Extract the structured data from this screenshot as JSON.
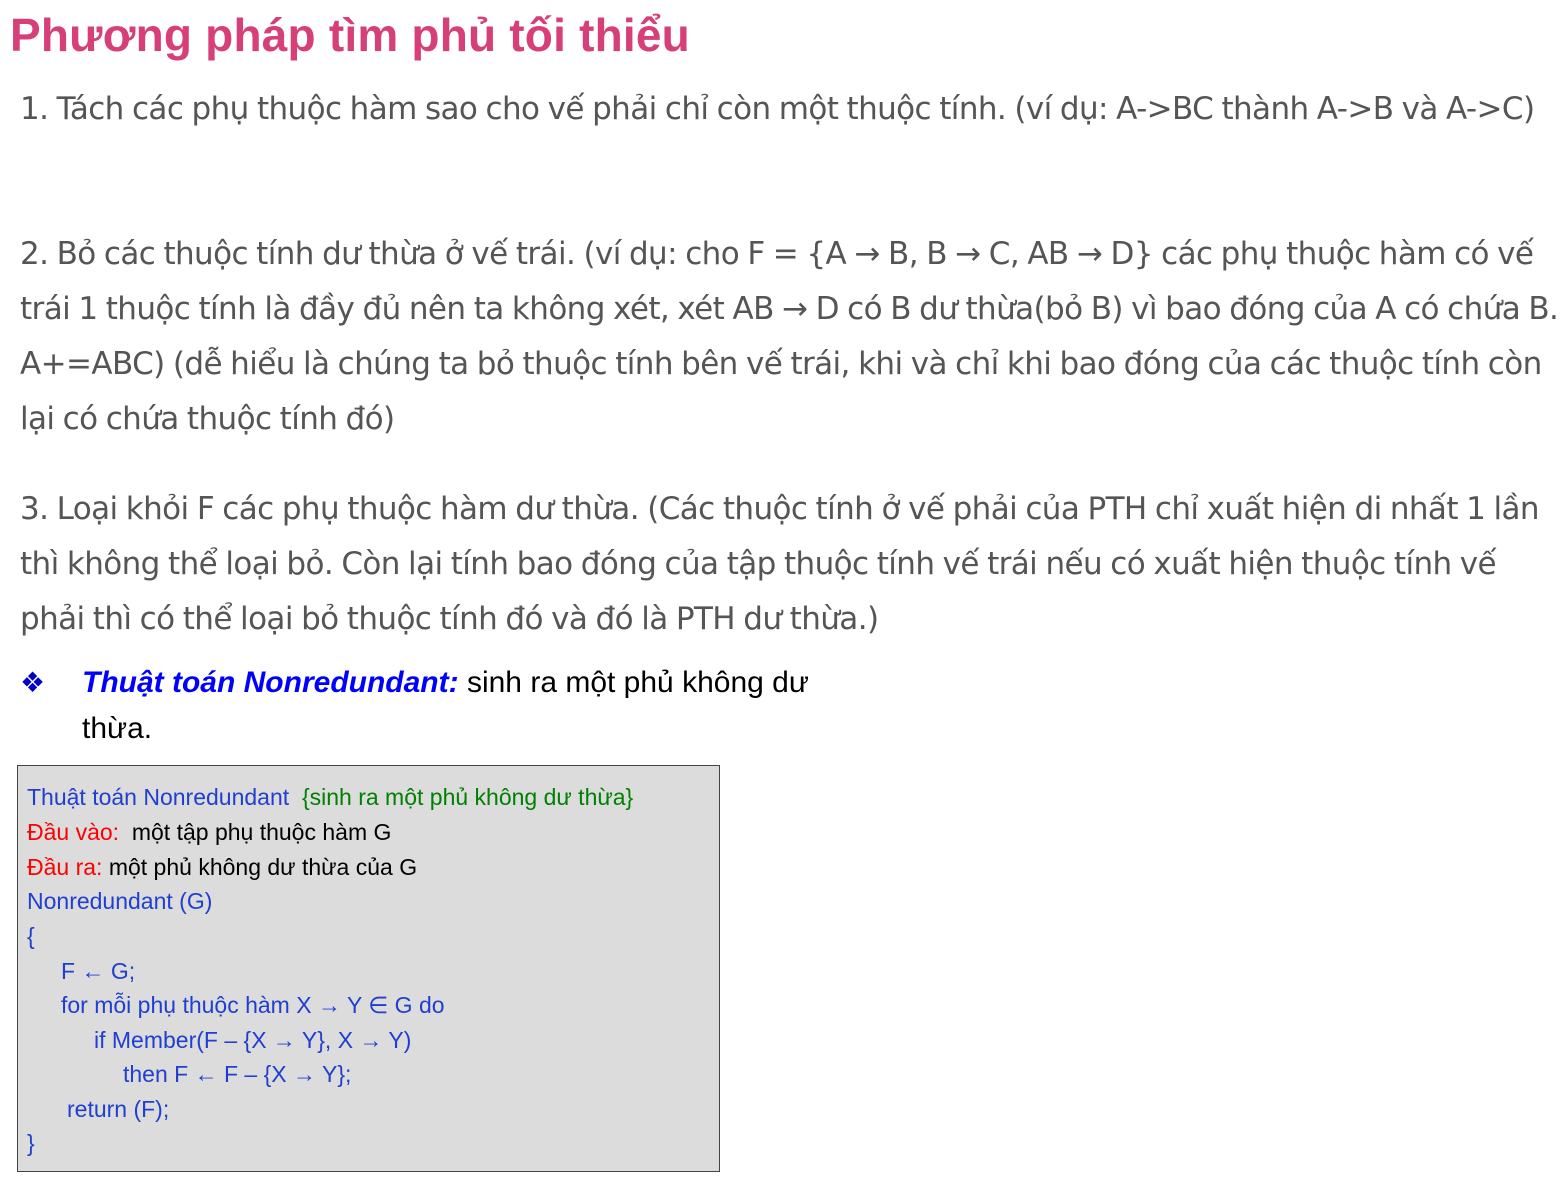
{
  "title": "Phương pháp tìm phủ tối thiểu",
  "steps": [
    "1. Tách các phụ thuộc hàm sao cho vế phải chỉ còn một thuộc tính. (ví dụ: A->BC thành A->B và A->C)",
    "2. Bỏ các thuộc tính dư thừa ở vế trái. (ví dụ: cho F = {A → B, B → C, AB → D} các phụ thuộc hàm có vế trái 1 thuộc tính là đầy đủ nên ta không xét, xét AB → D có B dư thừa(bỏ B) vì bao đóng của A có chứa B. A+=ABC) (dễ hiểu là chúng ta bỏ thuộc tính bên vế trái, khi và chỉ khi bao đóng của các thuộc tính còn lại có chứa thuộc tính đó)",
    "3. Loại khỏi F các phụ thuộc hàm dư thừa. (Các thuộc tính ở vế phải của PTH chỉ xuất hiện di nhất 1 lần thì không thể loại bỏ. Còn lại tính bao đóng của tập thuộc tính vế trái nếu có xuất hiện thuộc tính vế phải thì có thể loại bỏ thuộc tính đó và đó là PTH dư thừa.)"
  ],
  "bullet": {
    "icon": "❖",
    "icon_name": "diamond-bullet-icon",
    "head": "Thuật toán Nonredundant:",
    "text": " sinh ra một phủ không dư thừa."
  },
  "algorithm": {
    "name": "Thuật toán Nonredundant",
    "comment": "{sinh ra một phủ không dư thừa}",
    "input_label": "Đầu vào:",
    "input_text": "một tập phụ thuộc hàm G",
    "output_label": "Đầu ra:",
    "output_text": "một phủ không dư thừa của G",
    "code": [
      "Nonredundant (G)",
      "{",
      "F ← G;",
      "for mỗi phụ thuộc hàm X → Y ∈ G do",
      "if Member(F – {X → Y}, X → Y)",
      "then F ← F – {X → Y};",
      "return (F);",
      "}"
    ]
  },
  "colors": {
    "title": "#d63f78",
    "body_text": "#555555",
    "algo_blue": "#1f3fd0",
    "algo_green": "#008000",
    "algo_red": "#ff0000",
    "box_bg": "#dcdcdc"
  }
}
